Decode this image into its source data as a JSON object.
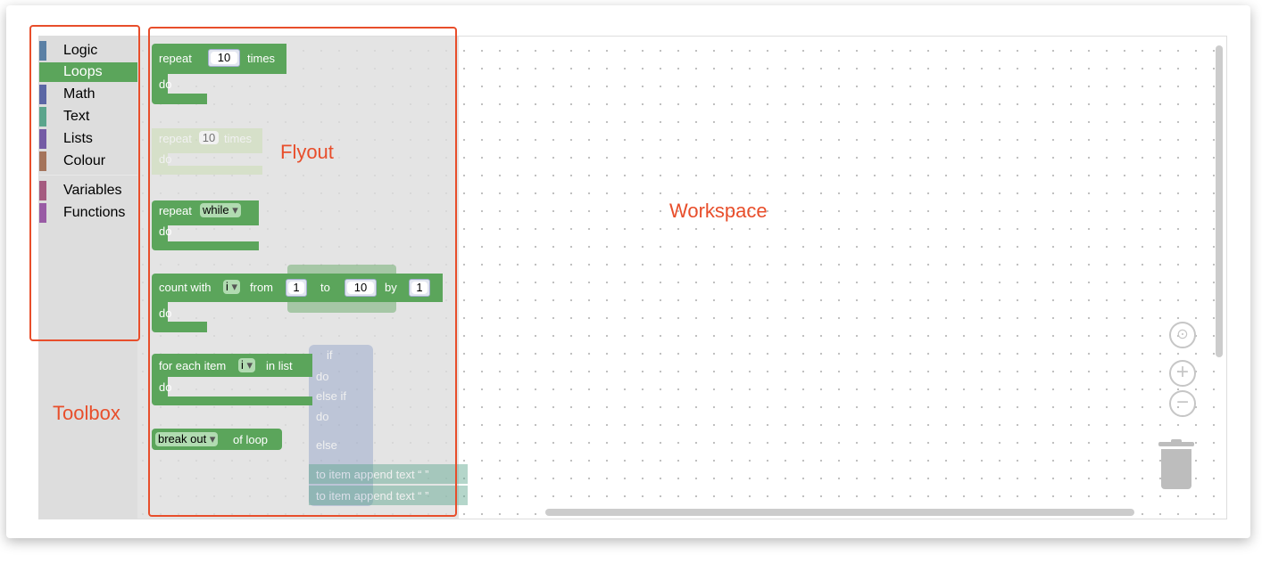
{
  "toolbox": {
    "items": [
      {
        "label": "Logic",
        "color": "#5b80a5"
      },
      {
        "label": "Loops",
        "color": "#5ba55b",
        "selected": true
      },
      {
        "label": "Math",
        "color": "#5b67a5"
      },
      {
        "label": "Text",
        "color": "#5ba58c"
      },
      {
        "label": "Lists",
        "color": "#745ba5"
      },
      {
        "label": "Colour",
        "color": "#a5745b"
      },
      {
        "label": "Variables",
        "color": "#a55b80"
      },
      {
        "label": "Functions",
        "color": "#995ba5"
      }
    ]
  },
  "flyout": {
    "repeat_times": {
      "repeat": "repeat",
      "count": "10",
      "times": "times",
      "do": "do"
    },
    "repeat_times_ghost": {
      "repeat": "repeat",
      "count": "10",
      "times": "times",
      "do": "do"
    },
    "repeat_while": {
      "repeat": "repeat",
      "mode": "while",
      "do": "do"
    },
    "count_with": {
      "label": "count with",
      "var": "i",
      "from": "from",
      "from_val": "1",
      "to": "to",
      "to_val": "10",
      "by": "by",
      "by_val": "1",
      "do": "do"
    },
    "for_each": {
      "label": "for each item",
      "var": "i",
      "in_list": "in list",
      "do": "do"
    },
    "break_out": {
      "mode": "break out",
      "of_loop": "of loop"
    },
    "ghost_if": {
      "if": "if",
      "do1": "do",
      "else_if": "else if",
      "do2": "do",
      "else": "else"
    },
    "ghost_append": {
      "line1": "to item append text “ ”",
      "line2": "to item append text “ ”"
    }
  },
  "annotations": {
    "toolbox": "Toolbox",
    "flyout": "Flyout",
    "workspace": "Workspace"
  },
  "icons": {
    "locate": "crosshair-icon",
    "zoom_in": "plus-icon",
    "zoom_out": "minus-icon",
    "trash": "trash-icon"
  },
  "colors": {
    "loops": "#5ba55b",
    "annotation": "#e84e2b",
    "toolbox_bg": "#dddddd"
  }
}
